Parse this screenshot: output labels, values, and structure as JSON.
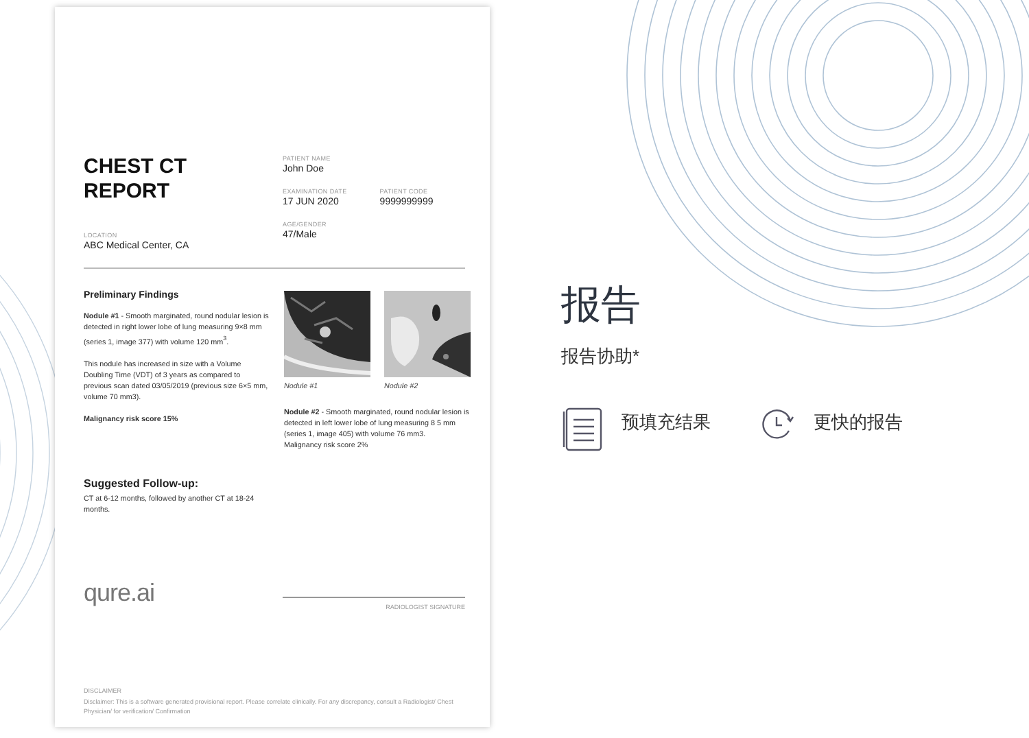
{
  "report": {
    "title": "CHEST CT REPORT",
    "location": {
      "label": "LOCATION",
      "value": "ABC Medical Center, CA"
    },
    "patient_name": {
      "label": "PATIENT NAME",
      "value": "John Doe"
    },
    "examination_date": {
      "label": "EXAMINATION DATE",
      "value": "17 JUN 2020"
    },
    "patient_code": {
      "label": "PATIENT CODE",
      "value": "9999999999"
    },
    "age_gender": {
      "label": "AGE/GENDER",
      "value": "47/Male"
    },
    "findings_heading": "Preliminary Findings",
    "findings": [
      "**Nodule #1** - Smooth marginated, round nodular lesion is detected in right lower lobe of lung measuring 9×8 mm (series 1, image 377) with volume 120 mm$^{3}$.",
      "This nodule has increased in size with a Volume Doubling Time (VDT) of 3 years as compared to previous scan dated 03/05/2019 (previous size 6×5 mm, volume 70 mm3).",
      "**Malignancy risk score 15%**"
    ],
    "images": [
      {
        "caption": "Nodule #1"
      },
      {
        "caption": "Nodule #2"
      }
    ],
    "nodule_2": [
      "**Nodule #2** - Smooth marginated, round nodular lesion is detected in left lower lobe of lung measuring 8    5 mm (series 1, image 405) with volume 76 mm3.",
      "Malignancy risk score 2%"
    ],
    "followup_heading": "Suggested Follow-up:",
    "followup": "CT at 6-12 months, followed by another CT at 18-24 months.",
    "logo": "qure.ai",
    "signature_label": "RADIOLOGIST SIGNATURE",
    "disclaimer_label": "DISCLAIMER",
    "disclaimer": "Disclaimer: This is a software generated provisional report. Please correlate clinically. For any discrepancy, consult a Radiologist/ Chest Physician/ for verification/ Confirmation"
  },
  "heading": "报告",
  "subheading": "报告协助*",
  "features": [
    {
      "kind": "document",
      "label": "预填充结果"
    },
    {
      "kind": "clock",
      "label": "更快的报告"
    }
  ]
}
